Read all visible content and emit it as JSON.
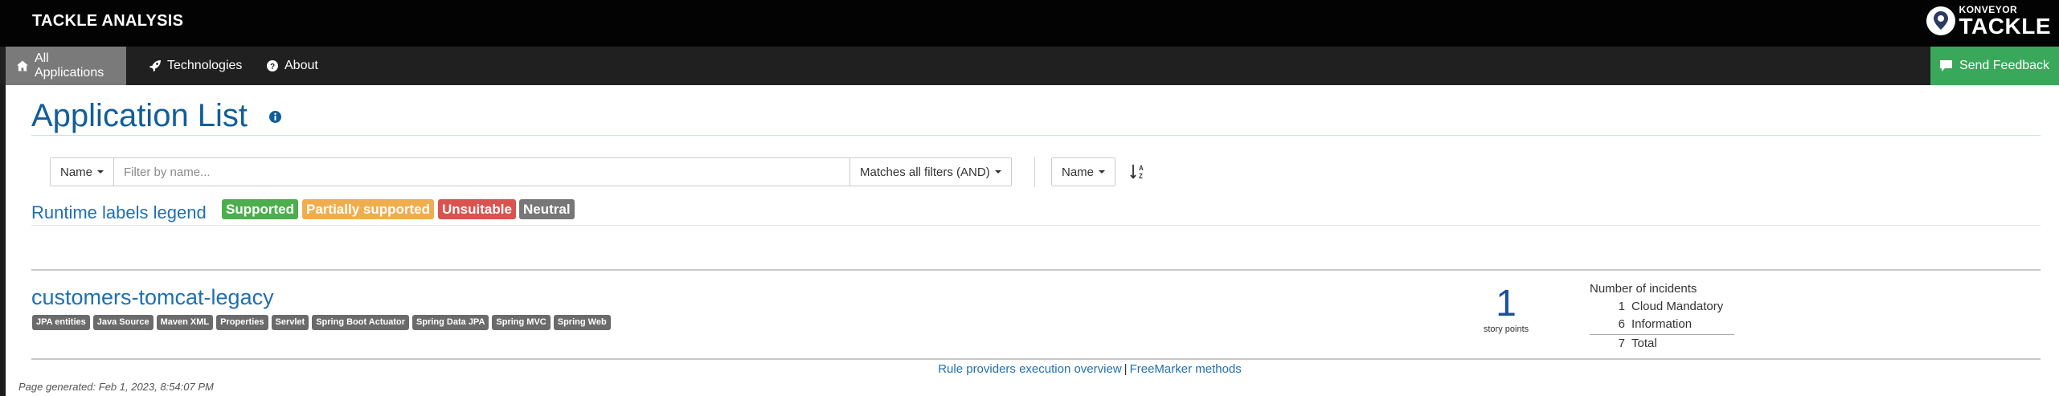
{
  "header": {
    "title": "TACKLE ANALYSIS",
    "brand_top": "KONVEYOR",
    "brand_bottom": "TACKLE"
  },
  "nav": {
    "items": [
      {
        "label": "All Applications",
        "icon": "home-icon",
        "active": true
      },
      {
        "label": "Technologies",
        "icon": "rocket-icon",
        "active": false
      },
      {
        "label": "About",
        "icon": "question-circle-icon",
        "active": false
      }
    ],
    "feedback_label": "Send Feedback"
  },
  "page": {
    "title": "Application List"
  },
  "filter": {
    "field_label": "Name",
    "placeholder": "Filter by name...",
    "match_label": "Matches all filters (AND)",
    "sort_label": "Name"
  },
  "legend": {
    "title": "Runtime labels legend",
    "badges": [
      {
        "label": "Supported",
        "color": "#4cae4c"
      },
      {
        "label": "Partially supported",
        "color": "#f0ad4e"
      },
      {
        "label": "Unsuitable",
        "color": "#d9534f"
      },
      {
        "label": "Neutral",
        "color": "#777777"
      }
    ]
  },
  "application": {
    "name": "customers-tomcat-legacy",
    "tags": [
      "JPA entities",
      "Java Source",
      "Maven XML",
      "Properties",
      "Servlet",
      "Spring Boot Actuator",
      "Spring Data JPA",
      "Spring MVC",
      "Spring Web"
    ],
    "story_points": "1",
    "story_points_label": "story points",
    "incidents": {
      "title": "Number of incidents",
      "rows": [
        {
          "count": "1",
          "label": "Cloud Mandatory"
        },
        {
          "count": "6",
          "label": "Information"
        }
      ],
      "total": {
        "count": "7",
        "label": "Total"
      }
    }
  },
  "footer": {
    "link1": "Rule providers execution overview",
    "separator": "|",
    "link2": "FreeMarker methods",
    "generated": "Page generated: Feb 1, 2023, 8:54:07 PM"
  },
  "colors": {
    "header_bg": "#030303",
    "nav_bg": "#202020",
    "nav_active": "#7a7a7a",
    "feedback_bg": "#39a85a",
    "title_blue": "#115e9a",
    "link_blue": "#1f6fb2"
  }
}
